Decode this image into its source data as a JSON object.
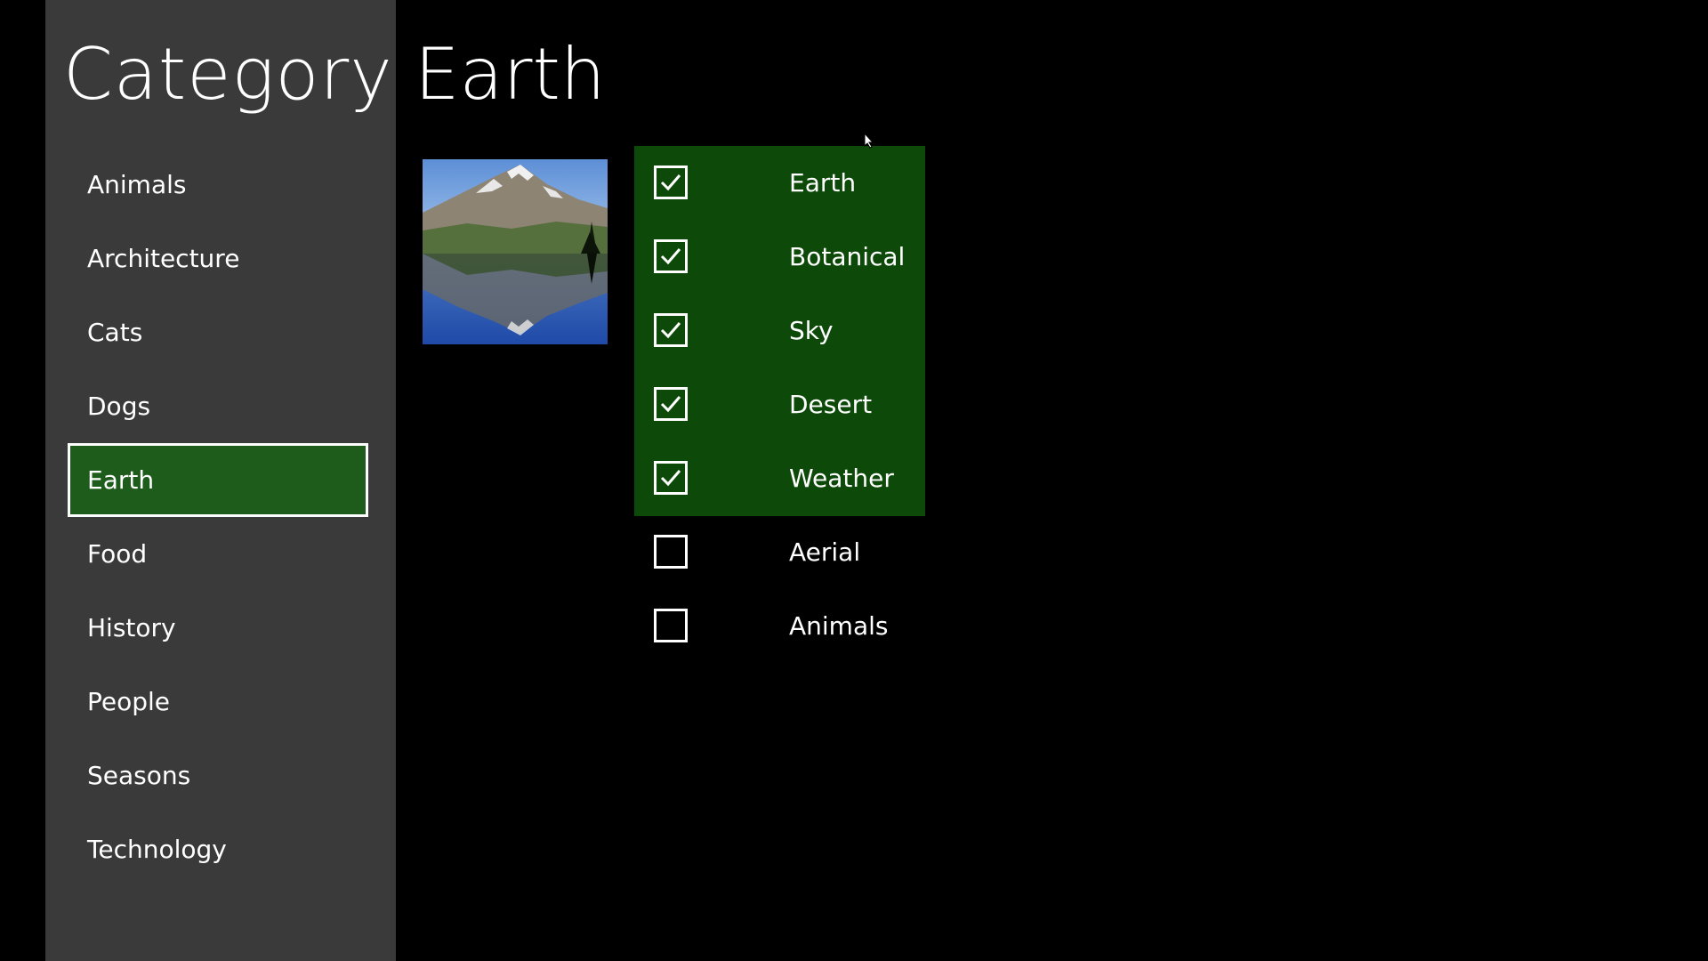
{
  "sidebar": {
    "title": "Category",
    "items": [
      {
        "label": "Animals",
        "selected": false
      },
      {
        "label": "Architecture",
        "selected": false
      },
      {
        "label": "Cats",
        "selected": false
      },
      {
        "label": "Dogs",
        "selected": false
      },
      {
        "label": "Earth",
        "selected": true
      },
      {
        "label": "Food",
        "selected": false
      },
      {
        "label": "History",
        "selected": false
      },
      {
        "label": "People",
        "selected": false
      },
      {
        "label": "Seasons",
        "selected": false
      },
      {
        "label": "Technology",
        "selected": false
      }
    ]
  },
  "main": {
    "title": "Earth",
    "thumbnail_icon": "mountain-lake-reflection-photo",
    "tags": [
      {
        "label": "Earth",
        "checked": true
      },
      {
        "label": "Botanical",
        "checked": true
      },
      {
        "label": "Sky",
        "checked": true
      },
      {
        "label": "Desert",
        "checked": true
      },
      {
        "label": "Weather",
        "checked": true
      },
      {
        "label": "Aerial",
        "checked": false
      },
      {
        "label": "Animals",
        "checked": false
      }
    ]
  },
  "colors": {
    "background": "#000000",
    "sidebar": "#3a3a3a",
    "selected_item": "#1e5c1b",
    "tag_panel": "#0d4a09",
    "text": "#ffffff"
  }
}
